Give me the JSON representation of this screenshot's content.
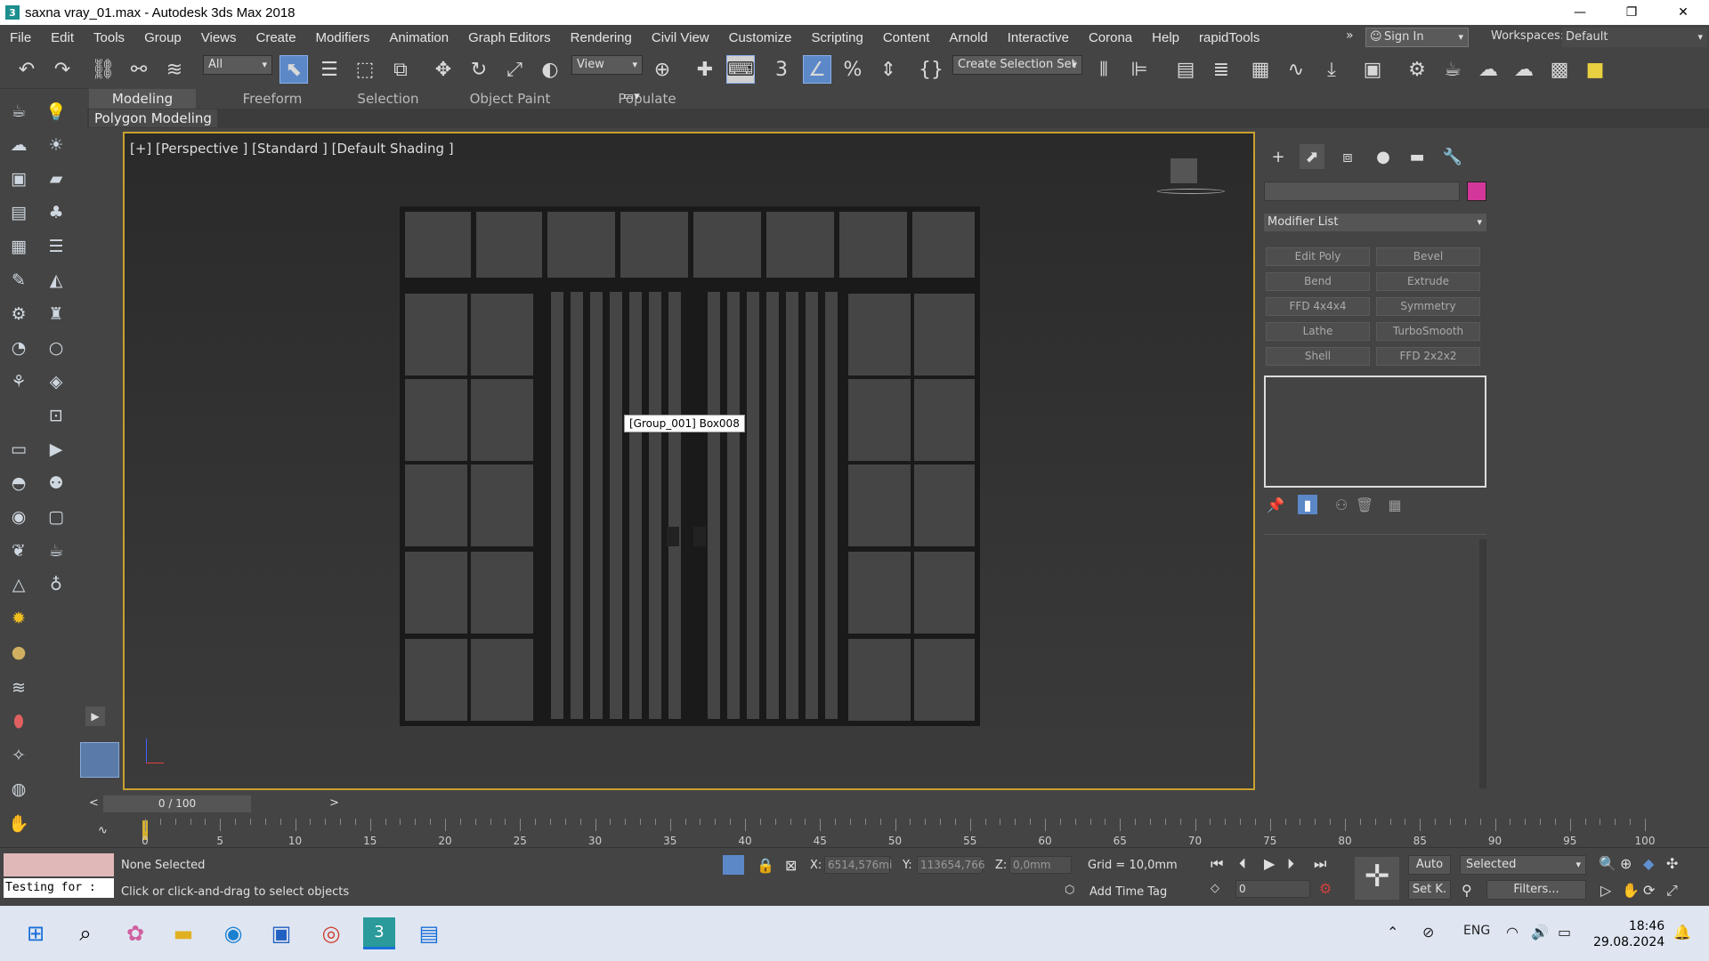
{
  "window": {
    "title": "saxna vray_01.max - Autodesk 3ds Max 2018",
    "app_icon": "3",
    "minimize": "—",
    "maximize": "❐",
    "close": "✕"
  },
  "menu": {
    "items": [
      "File",
      "Edit",
      "Tools",
      "Group",
      "Views",
      "Create",
      "Modifiers",
      "Animation",
      "Graph Editors",
      "Rendering",
      "Civil View",
      "Customize",
      "Scripting",
      "Content",
      "Arnold",
      "Interactive",
      "Corona",
      "Help",
      "rapidTools"
    ],
    "overflow": "»",
    "sign_in": "Sign In",
    "workspaces_label": "Workspaces:",
    "workspace_value": "Default"
  },
  "toolbar": {
    "filter_value": "All",
    "ref_coord_value": "View",
    "selection_set_value": "Create Selection Set"
  },
  "ribbon": {
    "tabs": [
      "Modeling",
      "Freeform",
      "Selection",
      "Object Paint",
      "Populate"
    ],
    "active_tab": "Modeling",
    "panel_label": "Polygon Modeling"
  },
  "viewport": {
    "label": "[+] [Perspective ] [Standard ] [Default Shading ]",
    "tooltip": "[Group_001] Box008"
  },
  "command_panel": {
    "modifier_list": "Modifier List",
    "modifier_buttons": [
      "Edit Poly",
      "Bevel",
      "Bend",
      "Extrude",
      "FFD 4x4x4",
      "Symmetry",
      "Lathe",
      "TurboSmooth",
      "Shell",
      "FFD 2x2x2"
    ],
    "color_swatch": "#d4379a"
  },
  "timeline": {
    "frame_display": "0 / 100",
    "prev": "<",
    "next": ">",
    "tick_labels": [
      "0",
      "5",
      "10",
      "15",
      "20",
      "25",
      "30",
      "35",
      "40",
      "45",
      "50",
      "55",
      "60",
      "65",
      "70",
      "75",
      "80",
      "85",
      "90",
      "95",
      "100"
    ]
  },
  "status": {
    "maxscript_text": "Testing for :",
    "selection_status": "None Selected",
    "prompt": "Click or click-and-drag to select objects",
    "x_label": "X:",
    "x_value": "6514,576mi",
    "y_label": "Y:",
    "y_value": "113654,766",
    "z_label": "Z:",
    "z_value": "0,0mm",
    "grid": "Grid = 10,0mm",
    "add_time_tag": "Add Time Tag",
    "auto_key": "Auto",
    "set_key": "Set K.",
    "key_filter_value": "Selected",
    "filters": "Filters...",
    "current_frame": "0"
  },
  "taskbar": {
    "language": "ENG",
    "time": "18:46",
    "date": "29.08.2024"
  }
}
